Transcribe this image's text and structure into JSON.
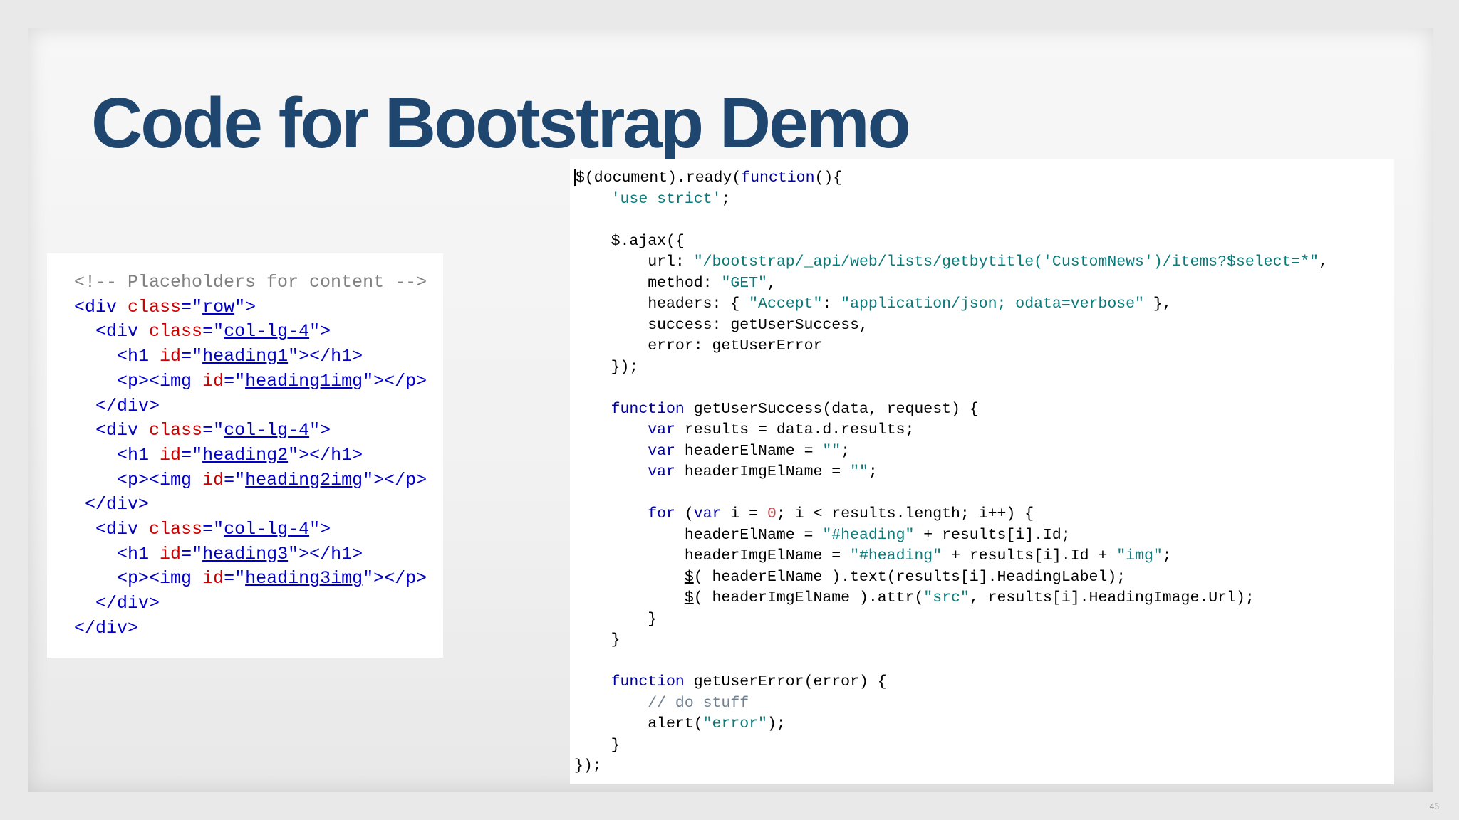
{
  "slide": {
    "title": "Code for Bootstrap Demo",
    "page_number": "45"
  },
  "html_code": {
    "comment": "<!-- Placeholders for content -->",
    "row_class": "row",
    "col_class": "col-lg-4",
    "headings": [
      {
        "id": "heading1",
        "img_id": "heading1img"
      },
      {
        "id": "heading2",
        "img_id": "heading2img"
      },
      {
        "id": "heading3",
        "img_id": "heading3img"
      }
    ]
  },
  "js_code": {
    "use_strict": "'use strict'",
    "url": "\"/bootstrap/_api/web/lists/getbytitle('CustomNews')/items?$select=*\"",
    "method": "\"GET\"",
    "accept_key": "\"Accept\"",
    "accept_value": "\"application/json; odata=verbose\"",
    "success_fn": "getUserSuccess",
    "error_fn": "getUserError",
    "empty_string": "\"\"",
    "heading_prefix": "\"#heading\"",
    "img_suffix": "\"img\"",
    "src_attr": "\"src\"",
    "comment": "// do stuff",
    "alert_msg": "\"error\""
  }
}
